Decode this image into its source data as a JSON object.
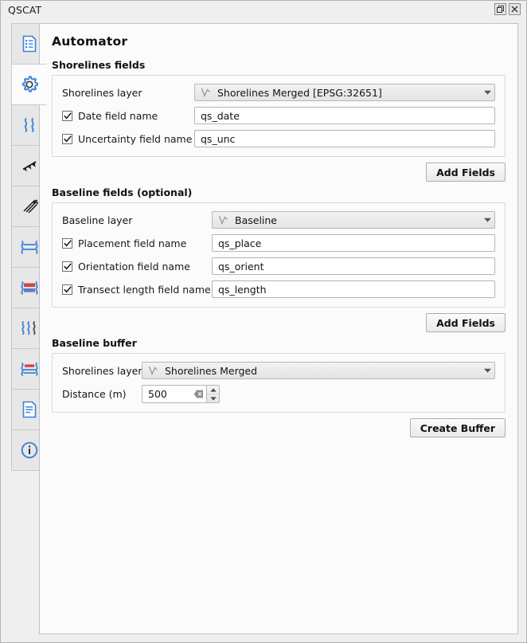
{
  "window": {
    "title": "QSCAT",
    "buttons": [
      {
        "name": "float-button",
        "icon": "float-icon"
      },
      {
        "name": "close-button",
        "icon": "close-icon"
      }
    ]
  },
  "sidebar": {
    "tabs": [
      {
        "name": "sidebar-tab-summary-reports",
        "icon": "document-list-icon",
        "selected": false
      },
      {
        "name": "sidebar-tab-automator",
        "icon": "gear-icon",
        "selected": true
      },
      {
        "name": "sidebar-tab-shorelines",
        "icon": "shorelines-icon",
        "selected": false
      },
      {
        "name": "sidebar-tab-baseline",
        "icon": "arrows-icon",
        "selected": false
      },
      {
        "name": "sidebar-tab-transects",
        "icon": "transects-icon",
        "selected": false
      },
      {
        "name": "sidebar-tab-shoreline-change",
        "icon": "change-rate-icon",
        "selected": false
      },
      {
        "name": "sidebar-tab-area-change",
        "icon": "area-change-icon",
        "selected": false
      },
      {
        "name": "sidebar-tab-forecasting",
        "icon": "forecasting-icon",
        "selected": false
      },
      {
        "name": "sidebar-tab-visualization",
        "icon": "visualization-icon",
        "selected": false
      },
      {
        "name": "sidebar-tab-summary",
        "icon": "report-icon",
        "selected": false
      },
      {
        "name": "sidebar-tab-about",
        "icon": "info-icon",
        "selected": false
      }
    ]
  },
  "page": {
    "title": "Automator"
  },
  "shorelines_fields": {
    "section_title": "Shorelines fields",
    "layer_label": "Shorelines layer",
    "layer_value": "Shorelines Merged [EPSG:32651]",
    "layer_icon": "vector-line-layer-icon",
    "date_checkbox_label": "Date field name",
    "date_checked": true,
    "date_value": "qs_date",
    "uncertainty_checkbox_label": "Uncertainty field name",
    "uncertainty_checked": true,
    "uncertainty_value": "qs_unc",
    "add_fields_button": "Add Fields"
  },
  "baseline_fields": {
    "section_title": "Baseline fields (optional)",
    "layer_label": "Baseline layer",
    "layer_value": "Baseline",
    "layer_icon": "vector-line-layer-icon",
    "placement_checkbox_label": "Placement field name",
    "placement_checked": true,
    "placement_value": "qs_place",
    "orientation_checkbox_label": "Orientation field name",
    "orientation_checked": true,
    "orientation_value": "qs_orient",
    "transect_length_checkbox_label": "Transect length field name",
    "transect_length_checked": true,
    "transect_length_value": "qs_length",
    "add_fields_button": "Add Fields"
  },
  "baseline_buffer": {
    "section_title": "Baseline buffer",
    "layer_label": "Shorelines layer",
    "layer_value": "Shorelines Merged",
    "layer_icon": "vector-line-layer-icon",
    "distance_label": "Distance (m)",
    "distance_value": "500",
    "clear_icon": "clear-icon",
    "create_buffer_button": "Create Buffer"
  },
  "colors": {
    "accent": "#3b82d6",
    "window_bg": "#efefef",
    "panel_bg": "#fbfbfb",
    "text": "#141414"
  }
}
